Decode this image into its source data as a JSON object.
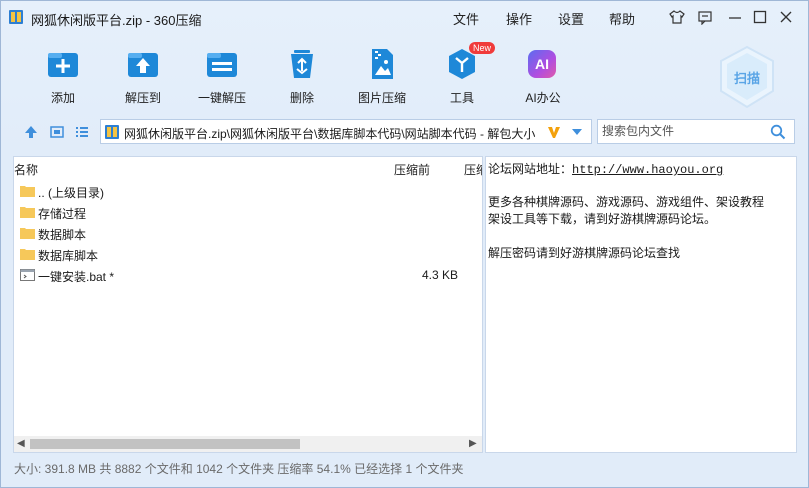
{
  "window": {
    "title": "网狐休闲版平台.zip - 360压缩"
  },
  "menu": {
    "file": "文件",
    "operate": "操作",
    "settings": "设置",
    "help": "帮助"
  },
  "toolbar": {
    "add": "添加",
    "extract_to": "解压到",
    "one_click_extract": "一键解压",
    "delete": "删除",
    "image_compress": "图片压缩",
    "tools": "工具",
    "tools_badge": "New",
    "ai_office": "AI办公",
    "ai_icon_text": "AI",
    "scan": "扫描"
  },
  "address": {
    "path": "网狐休闲版平台.zip\\网狐休闲版平台\\数据库脚本代码\\网站脚本代码 - 解包大小",
    "search_placeholder": "搜索包内文件"
  },
  "columns": {
    "name": "名称",
    "compressed_before": "压缩前",
    "compressed_after": "压缩"
  },
  "files": [
    {
      "name": ".. (上级目录)",
      "size": "",
      "type": "folder"
    },
    {
      "name": "存储过程",
      "size": "",
      "type": "folder"
    },
    {
      "name": "数据脚本",
      "size": "",
      "type": "folder"
    },
    {
      "name": "数据库脚本",
      "size": "",
      "type": "folder"
    },
    {
      "name": "一键安装.bat *",
      "size": "4.3 KB",
      "type": "bat"
    }
  ],
  "info": {
    "forum_label": "论坛网站地址：",
    "forum_url": "http://www.haoyou.org",
    "line2": "更多各种棋牌源码、游戏源码、游戏组件、架设教程",
    "line3": "架设工具等下载，请到好游棋牌源码论坛。",
    "line4": "解压密码请到好游棋牌源码论坛查找"
  },
  "status": {
    "text": "大小: 391.8 MB 共 8882 个文件和 1042 个文件夹 压缩率 54.1% 已经选择 1 个文件夹"
  },
  "colors": {
    "accent_blue": "#1e88d8",
    "folder_yellow": "#f6c85a",
    "ai_purple": "#9b4bdb",
    "badge_red": "#f03b3b"
  }
}
